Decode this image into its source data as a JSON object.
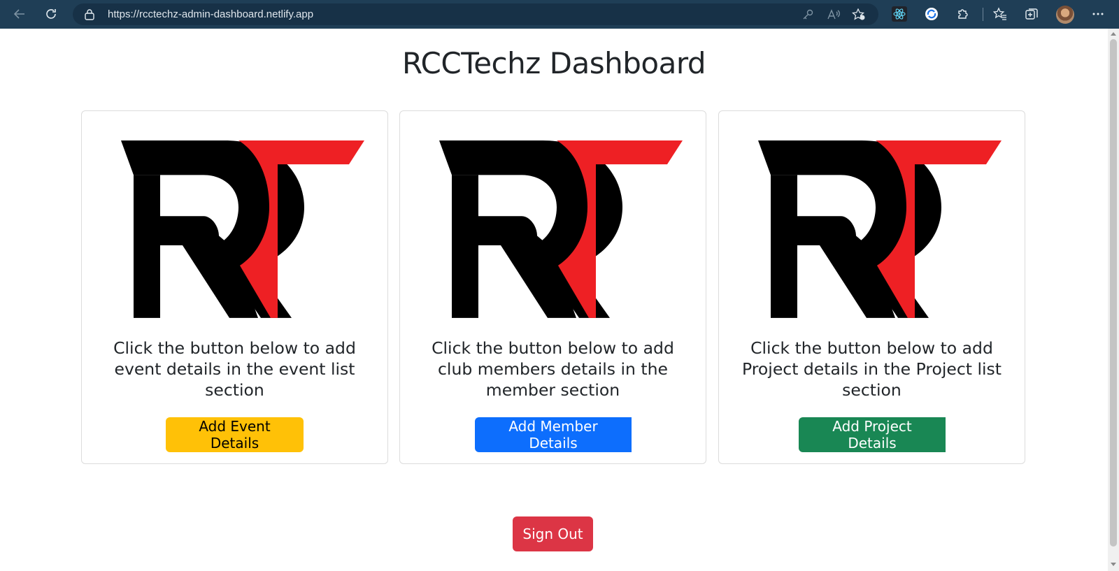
{
  "browser": {
    "url": "https://rcctechz-admin-dashboard.netlify.app"
  },
  "page": {
    "title": "RCCTechz Dashboard"
  },
  "cards": [
    {
      "description": "Click the button below to add event details in the event list section",
      "button_label": "Add Event Details",
      "button_color": "#ffc107"
    },
    {
      "description": "Click the button below to add club members details in the member section",
      "button_label": "Add Member Details",
      "button_color": "#0d6efd"
    },
    {
      "description": "Click the button below to add Project details in the Project list section",
      "button_label": "Add Project Details",
      "button_color": "#198754"
    }
  ],
  "sign_out": {
    "label": "Sign Out",
    "color": "#dc3545"
  },
  "logo_colors": {
    "black": "#000000",
    "red": "#ee2024"
  }
}
